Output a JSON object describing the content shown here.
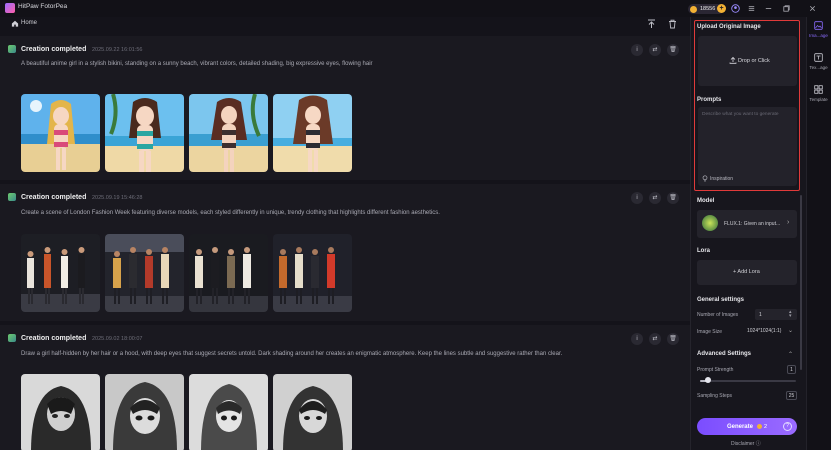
{
  "app": {
    "title": "HitPaw FotorPea",
    "coins": "18556"
  },
  "breadcrumb": {
    "home_label": "Home"
  },
  "feed": {
    "entries": [
      {
        "status": "Creation completed",
        "time": "2025.09.22  16:01:56",
        "prompt": "A beautiful anime girl in a stylish bikini, standing on a sunny beach, vibrant colors, detailed shading, big expressive eyes, flowing hair",
        "theme": "beach"
      },
      {
        "status": "Creation completed",
        "time": "2025.09.19  15:46:28",
        "prompt": "Create a scene of London Fashion Week featuring diverse models, each styled differently in unique, trendy clothing that highlights different fashion aesthetics.",
        "theme": "runway"
      },
      {
        "status": "Creation completed",
        "time": "2025.09.02  18:00:07",
        "prompt": "Draw a girl half-hidden by her hair or a hood, with deep eyes that suggest secrets untold. Dark shading around her creates an enigmatic atmosphere. Keep the lines subtle and suggestive rather than clear.",
        "theme": "hood"
      }
    ]
  },
  "panel": {
    "upload_title": "Upload Original Image",
    "drop_label": "Drop or Click",
    "prompts_title": "Prompts",
    "prompt_placeholder": "Describe what you want to generate",
    "inspiration_label": "Inspiration",
    "model_title": "Model",
    "model_name": "FLUX.1: Given an input...",
    "lora_title": "Lora",
    "add_lora_label": "+ Add Lora",
    "general_title": "General settings",
    "num_images_label": "Number of Images",
    "num_images_value": "1",
    "image_size_label": "Image Size",
    "image_size_value": "1024*1024(1:1)",
    "advanced_title": "Advanced Settings",
    "prompt_strength_label": "Prompt Strength",
    "prompt_strength_value": "1",
    "prompt_strength_fraction": 0.08,
    "sampling_steps_label": "Sampling Steps",
    "sampling_steps_value": "25",
    "generate_label": "Generate",
    "generate_cost": "2",
    "disclaimer_label": "Disclaimer"
  },
  "rail": {
    "items": [
      {
        "label": "Ima...age",
        "icon": "image-icon"
      },
      {
        "label": "Tex...age",
        "icon": "text-icon"
      },
      {
        "label": "Template",
        "icon": "template-icon"
      }
    ]
  }
}
